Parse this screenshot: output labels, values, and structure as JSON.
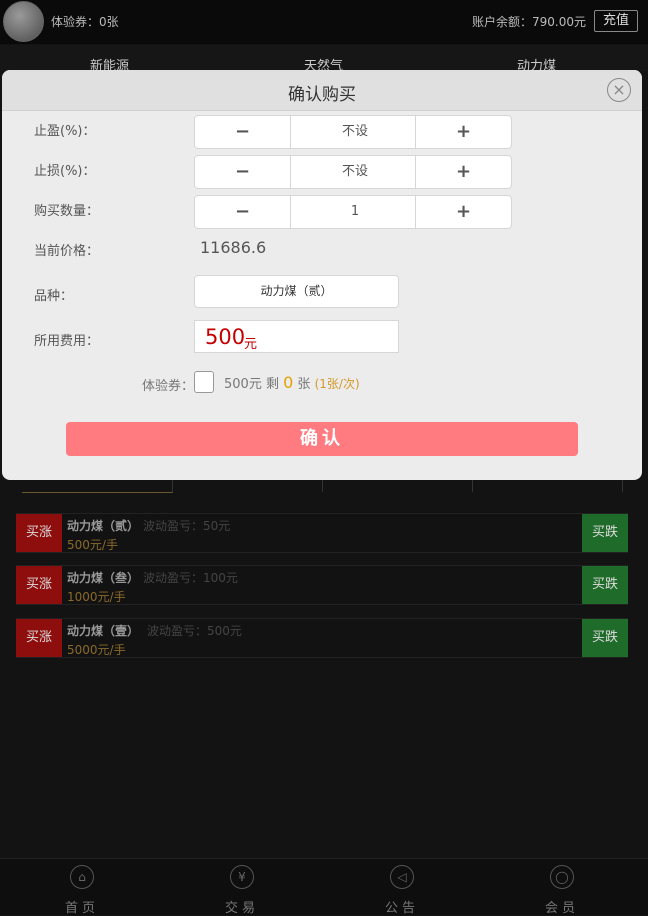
{
  "header": {
    "coupon_count": "体验券：0张",
    "balance": "账户余额：790.00元",
    "recharge": "充值"
  },
  "categories": [
    "新能源",
    "天然气",
    "动力煤"
  ],
  "products": [
    {
      "buy_up": "买涨",
      "name": "动力煤（贰）",
      "wave": "波动盈亏：50元",
      "price": "500元/手",
      "buy_down": "买跌"
    },
    {
      "buy_up": "买涨",
      "name": "动力煤（叁）",
      "wave": "波动盈亏：100元",
      "price": "1000元/手",
      "buy_down": "买跌"
    },
    {
      "buy_up": "买涨",
      "name": "动力煤（壹）",
      "wave": "波动盈亏：500元",
      "price": "5000元/手",
      "buy_down": "买跌"
    }
  ],
  "nav": [
    {
      "label": "首页",
      "icon": "home-icon",
      "glyph": "⌂"
    },
    {
      "label": "交易",
      "icon": "yuan-icon",
      "glyph": "¥"
    },
    {
      "label": "公告",
      "icon": "speaker-icon",
      "glyph": "◁"
    },
    {
      "label": "会员",
      "icon": "user-icon",
      "glyph": "◯"
    }
  ],
  "modal": {
    "title": "确认购买",
    "close_glyph": "×",
    "take_profit_label": "止盈(%)：",
    "take_profit_value": "不设",
    "stop_loss_label": "止损(%)：",
    "stop_loss_value": "不设",
    "quantity_label": "购买数量：",
    "quantity_value": "1",
    "minus": "−",
    "plus": "+",
    "price_label": "当前价格：",
    "price_value": "11686.6",
    "variety_label": "品种：",
    "variety_value": "动力煤（贰）",
    "fee_label": "所用费用：",
    "fee_value": "500",
    "fee_unit": "元",
    "coupon_label": "体验券：",
    "coupon_amount": "500元 剩",
    "coupon_remaining": "0",
    "coupon_unit": "张",
    "coupon_rule": "(1张/次)",
    "confirm": "确认"
  }
}
